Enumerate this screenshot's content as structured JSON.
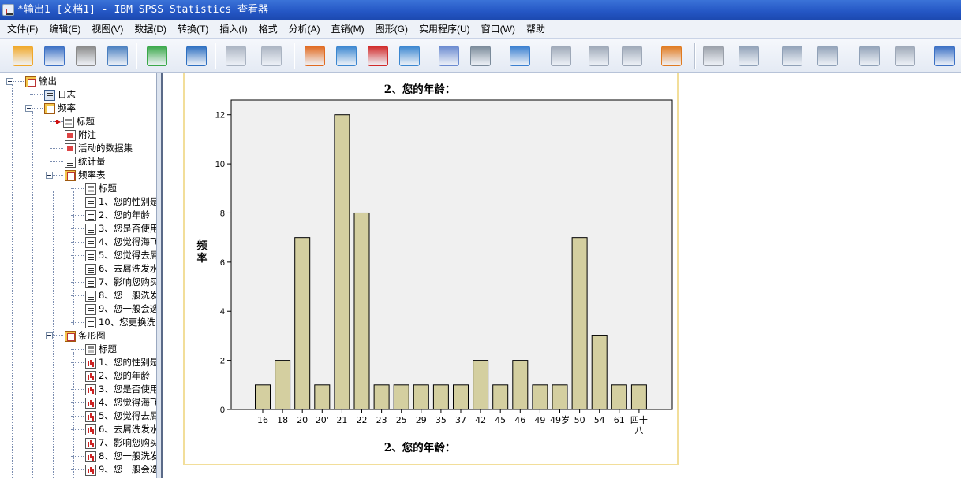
{
  "window": {
    "title": "*输出1 [文档1] - IBM SPSS Statistics 查看器"
  },
  "menu": [
    "文件(F)",
    "编辑(E)",
    "视图(V)",
    "数据(D)",
    "转换(T)",
    "插入(I)",
    "格式",
    "分析(A)",
    "直销(M)",
    "图形(G)",
    "实用程序(U)",
    "窗口(W)",
    "帮助"
  ],
  "toolbar": {
    "icons": [
      "open-folder-icon",
      "save-icon",
      "print-icon",
      "print-preview-icon",
      "export-icon",
      "recall-dialog-icon",
      "undo-icon",
      "redo-icon",
      "goto-case-icon",
      "goto-variable-icon",
      "insert-cases-icon",
      "variables-icon",
      "select-cases-icon",
      "weight-cases-icon",
      "split-file-icon",
      "designate-window-icon",
      "insert-heading-icon",
      "insert-title-icon",
      "insert-text-icon",
      "show-all-icon",
      "hide-icon",
      "promote-icon",
      "demote-icon",
      "expand-icon",
      "collapse-icon",
      "show-icon",
      "hide-outline-icon",
      "designate-icon"
    ]
  },
  "outline": {
    "nodes": [
      {
        "label": "输出",
        "icon": "book-icon",
        "level": 0,
        "toggle": true
      },
      {
        "label": "日志",
        "icon": "log-icon",
        "level": 1
      },
      {
        "label": "频率",
        "icon": "book-icon",
        "level": 1,
        "toggle": true
      },
      {
        "label": "标题",
        "icon": "title-icon",
        "level": 2,
        "selected": true
      },
      {
        "label": "附注",
        "icon": "note-icon",
        "level": 2
      },
      {
        "label": "活动的数据集",
        "icon": "note-icon",
        "level": 2
      },
      {
        "label": "统计量",
        "icon": "table-icon",
        "level": 2
      },
      {
        "label": "频率表",
        "icon": "book-icon",
        "level": 2,
        "toggle": true
      },
      {
        "label": "标题",
        "icon": "title-icon",
        "level": 3
      },
      {
        "label": "1、您的性别是",
        "icon": "table-icon",
        "level": 3
      },
      {
        "label": "2、您的年龄",
        "icon": "table-icon",
        "level": 3
      },
      {
        "label": "3、您是否使用",
        "icon": "table-icon",
        "level": 3
      },
      {
        "label": "4、您觉得海飞",
        "icon": "table-icon",
        "level": 3
      },
      {
        "label": "5、您觉得去屑",
        "icon": "table-icon",
        "level": 3
      },
      {
        "label": "6、去屑洗发水",
        "icon": "table-icon",
        "level": 3
      },
      {
        "label": "7、影响您购买",
        "icon": "table-icon",
        "level": 3
      },
      {
        "label": "8、您一般洗发",
        "icon": "table-icon",
        "level": 3
      },
      {
        "label": "9、您一般会选",
        "icon": "table-icon",
        "level": 3
      },
      {
        "label": "10、您更换洗",
        "icon": "table-icon",
        "level": 3
      },
      {
        "label": "条形图",
        "icon": "book-icon",
        "level": 2,
        "toggle": true
      },
      {
        "label": "标题",
        "icon": "title-icon",
        "level": 3
      },
      {
        "label": "1、您的性别是",
        "icon": "bar-chart-icon",
        "level": 3
      },
      {
        "label": "2、您的年龄",
        "icon": "bar-chart-icon",
        "level": 3
      },
      {
        "label": "3、您是否使用",
        "icon": "bar-chart-icon",
        "level": 3
      },
      {
        "label": "4、您觉得海飞",
        "icon": "bar-chart-icon",
        "level": 3
      },
      {
        "label": "5、您觉得去屑",
        "icon": "bar-chart-icon",
        "level": 3
      },
      {
        "label": "6、去屑洗发水",
        "icon": "bar-chart-icon",
        "level": 3
      },
      {
        "label": "7、影响您购买",
        "icon": "bar-chart-icon",
        "level": 3
      },
      {
        "label": "8、您一般洗发",
        "icon": "bar-chart-icon",
        "level": 3
      },
      {
        "label": "9、您一般会选",
        "icon": "bar-chart-icon",
        "level": 3
      }
    ]
  },
  "chart_data": {
    "type": "bar",
    "title": "2、您的年龄：",
    "xlabel": "2、您的年龄：",
    "ylabel": "频率",
    "categories": [
      "16",
      "18",
      "20",
      "20'",
      "21",
      "22",
      "23",
      "25",
      "29",
      "35",
      "37",
      "42",
      "45",
      "46",
      "49",
      "49岁",
      "50",
      "54",
      "61",
      "四十八"
    ],
    "values": [
      1,
      2,
      7,
      1,
      12,
      8,
      1,
      1,
      1,
      1,
      1,
      2,
      1,
      2,
      1,
      1,
      7,
      3,
      1,
      1
    ],
    "ylim": [
      0,
      12.6
    ],
    "yticks": [
      0,
      2,
      4,
      6,
      8,
      10,
      12
    ],
    "grid": false,
    "bar_color": "#d4cfa0",
    "plot_background": "#f0f0f0"
  }
}
